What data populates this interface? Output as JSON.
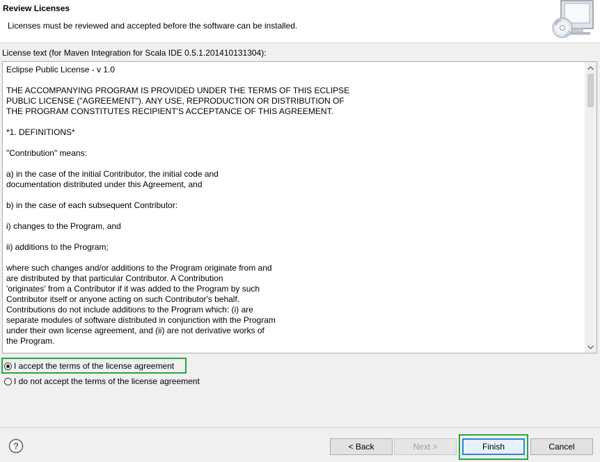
{
  "header": {
    "title": "Review Licenses",
    "description": "Licenses must be reviewed and accepted before the software can be installed.",
    "icon": "install-cd-monitor-icon"
  },
  "license": {
    "label": "License text (for Maven Integration for Scala IDE 0.5.1.201410131304):",
    "text": "Eclipse Public License - v 1.0\n\nTHE ACCOMPANYING PROGRAM IS PROVIDED UNDER THE TERMS OF THIS ECLIPSE\nPUBLIC LICENSE (\"AGREEMENT\"). ANY USE, REPRODUCTION OR DISTRIBUTION OF\nTHE PROGRAM CONSTITUTES RECIPIENT'S ACCEPTANCE OF THIS AGREEMENT.\n\n*1. DEFINITIONS*\n\n\"Contribution\" means:\n\na) in the case of the initial Contributor, the initial code and\ndocumentation distributed under this Agreement, and\n\nb) in the case of each subsequent Contributor:\n\ni) changes to the Program, and\n\nii) additions to the Program;\n\nwhere such changes and/or additions to the Program originate from and\nare distributed by that particular Contributor. A Contribution\n'originates' from a Contributor if it was added to the Program by such\nContributor itself or anyone acting on such Contributor's behalf.\nContributions do not include additions to the Program which: (i) are\nseparate modules of software distributed in conjunction with the Program\nunder their own license agreement, and (ii) are not derivative works of\nthe Program."
  },
  "options": {
    "accept": "I accept the terms of the license agreement",
    "decline": "I do not accept the terms of the license agreement",
    "selected": "accept"
  },
  "footer": {
    "help_icon": "help-icon",
    "back": "< Back",
    "next": "Next >",
    "finish": "Finish",
    "cancel": "Cancel"
  },
  "colors": {
    "highlight": "#22a83a",
    "default_button_border": "#2f7fd8"
  }
}
